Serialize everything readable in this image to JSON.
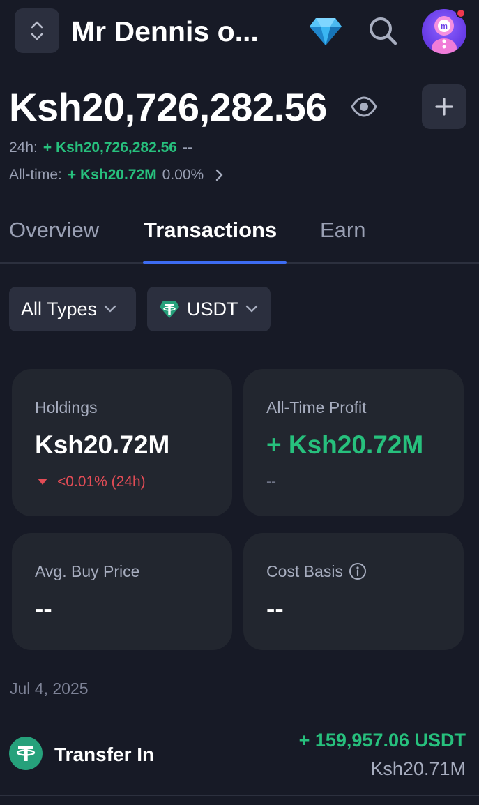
{
  "header": {
    "portfolio_name": "Mr Dennis o...",
    "icons": [
      "switcher-chevrons-icon",
      "diamond-icon",
      "search-icon",
      "avatar"
    ]
  },
  "balance": {
    "total": "Ksh20,726,282.56",
    "change_24h_label": "24h:",
    "change_24h_value": "+ Ksh20,726,282.56",
    "change_24h_pct": "--",
    "alltime_label": "All-time:",
    "alltime_value": "+ Ksh20.72M",
    "alltime_pct": "0.00%"
  },
  "tabs": [
    {
      "label": "Overview",
      "active": false
    },
    {
      "label": "Transactions",
      "active": true
    },
    {
      "label": "Earn",
      "active": false
    }
  ],
  "filters": {
    "type": "All Types",
    "coin": "USDT"
  },
  "cards": {
    "holdings": {
      "label": "Holdings",
      "value": "Ksh20.72M",
      "change": "<0.01% (24h)"
    },
    "profit": {
      "label": "All-Time Profit",
      "value": "+ Ksh20.72M",
      "sub": "--"
    },
    "avg_buy": {
      "label": "Avg. Buy Price",
      "value": "--"
    },
    "cost_basis": {
      "label": "Cost Basis",
      "value": "--"
    }
  },
  "transactions": {
    "date": "Jul 4, 2025",
    "items": [
      {
        "title": "Transfer In",
        "amount": "+ 159,957.06 USDT",
        "fiat": "Ksh20.71M"
      }
    ]
  },
  "colors": {
    "background": "#171a26",
    "card": "#22262f",
    "accent": "#3d6cf2",
    "positive": "#27c07d",
    "negative": "#e34c56",
    "tether": "#26a17b"
  }
}
